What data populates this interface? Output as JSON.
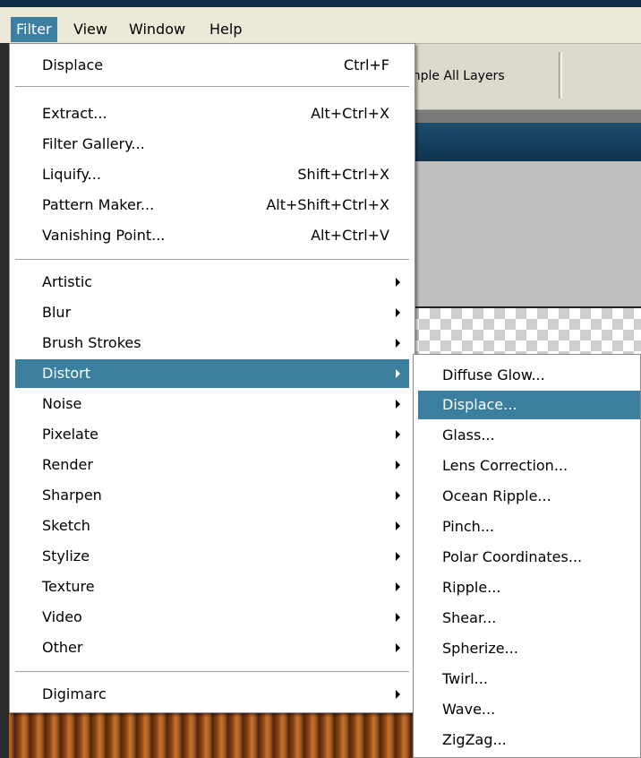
{
  "menubar": {
    "items": [
      "Filter",
      "View",
      "Window",
      "Help"
    ]
  },
  "options_bar": {
    "sample_all_layers_partial": "mple All Layers"
  },
  "filter_menu": {
    "last_filter": {
      "label": "Displace",
      "shortcut": "Ctrl+F"
    },
    "special_filters": [
      {
        "label": "Extract...",
        "shortcut": "Alt+Ctrl+X"
      },
      {
        "label": "Filter Gallery...",
        "shortcut": ""
      },
      {
        "label": "Liquify...",
        "shortcut": "Shift+Ctrl+X"
      },
      {
        "label": "Pattern Maker...",
        "shortcut": "Alt+Shift+Ctrl+X"
      },
      {
        "label": "Vanishing Point...",
        "shortcut": "Alt+Ctrl+V"
      }
    ],
    "categories": [
      "Artistic",
      "Blur",
      "Brush Strokes",
      "Distort",
      "Noise",
      "Pixelate",
      "Render",
      "Sharpen",
      "Sketch",
      "Stylize",
      "Texture",
      "Video",
      "Other"
    ],
    "highlighted_category": "Distort",
    "plugins": [
      "Digimarc"
    ]
  },
  "distort_submenu": {
    "items": [
      "Diffuse Glow...",
      "Displace...",
      "Glass...",
      "Lens Correction...",
      "Ocean Ripple...",
      "Pinch...",
      "Polar Coordinates...",
      "Ripple...",
      "Shear...",
      "Spherize...",
      "Twirl...",
      "Wave...",
      "ZigZag..."
    ],
    "highlighted_item": "Displace..."
  }
}
